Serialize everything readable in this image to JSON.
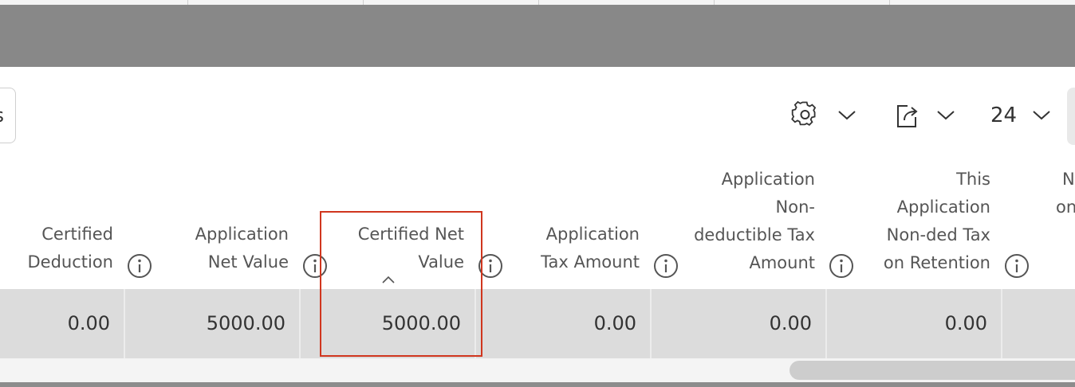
{
  "toolbar": {
    "left_button_text": "s",
    "page_size": "24",
    "icons": [
      "gear-icon",
      "chevron-down-icon",
      "export-icon",
      "chevron-down-icon",
      "chevron-down-icon"
    ]
  },
  "columns": [
    {
      "key": "certified_deduction",
      "lines": [
        "Certified",
        "Deduction"
      ]
    },
    {
      "key": "application_net_value",
      "lines": [
        "Application",
        "Net Value"
      ]
    },
    {
      "key": "certified_net_value",
      "lines": [
        "Certified Net",
        "Value"
      ],
      "sorted": "ascending",
      "highlighted": true
    },
    {
      "key": "application_tax_amount",
      "lines": [
        "Application",
        "Tax Amount"
      ]
    },
    {
      "key": "application_nonded_tax",
      "lines": [
        "Application",
        "Non-",
        "deductible Tax",
        "Amount"
      ]
    },
    {
      "key": "this_app_nonded_retention",
      "lines": [
        "This",
        "Application",
        "Non-ded Tax",
        "on Retention"
      ]
    },
    {
      "key": "partial",
      "lines": [
        "",
        "",
        "N",
        "on"
      ]
    }
  ],
  "row": {
    "certified_deduction": "0.00",
    "application_net_value": "5000.00",
    "certified_net_value": "5000.00",
    "application_tax_amount": "0.00",
    "application_nonded_tax": "0.00",
    "this_app_nonded_retention": "0.00"
  },
  "colors": {
    "overlay": "#888888",
    "row_bg": "#dcdcdc",
    "highlight": "#d0361e"
  }
}
